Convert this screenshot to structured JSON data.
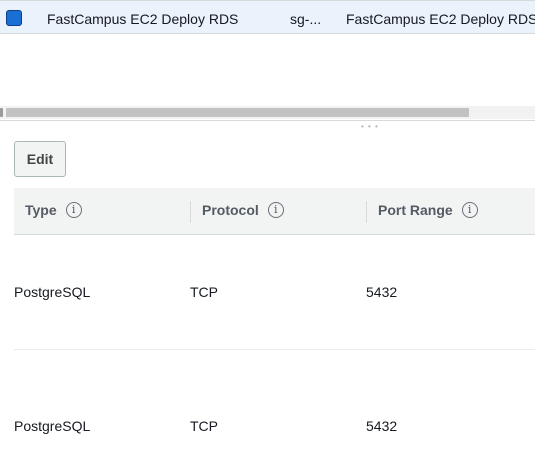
{
  "selected_group": {
    "name": "FastCampus EC2 Deploy RDS",
    "group_id": "sg-...",
    "description": "FastCampus EC2 Deploy RDS"
  },
  "rules_panel": {
    "edit_label": "Edit",
    "columns": [
      {
        "label": "Type",
        "info": "i"
      },
      {
        "label": "Protocol",
        "info": "i"
      },
      {
        "label": "Port Range",
        "info": "i"
      }
    ],
    "rows": [
      {
        "type": "PostgreSQL",
        "protocol": "TCP",
        "port_range": "5432"
      },
      {
        "type": "PostgreSQL",
        "protocol": "TCP",
        "port_range": "5432"
      }
    ]
  },
  "colors": {
    "selected_row_bg": "#eaf2fb",
    "checkbox_blue": "#1a6fd4",
    "header_bg": "#f2f3f3"
  }
}
